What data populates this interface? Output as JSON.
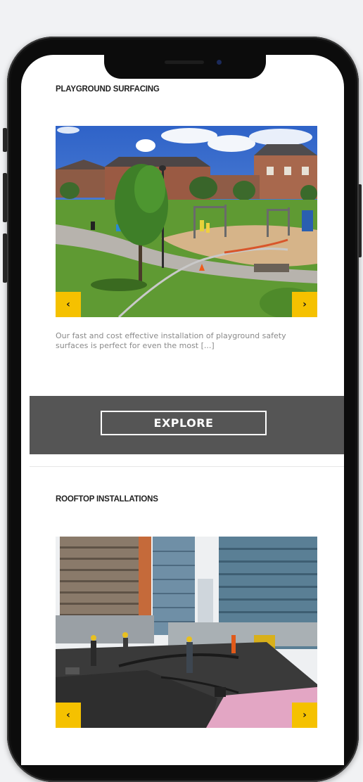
{
  "sections": [
    {
      "title": "PLAYGROUND SURFACING",
      "excerpt": "Our fast and cost effective installation of playground safety surfaces is perfect for even the most [...]",
      "explore_label": "EXPLORE",
      "prev_label": "‹",
      "next_label": "›"
    },
    {
      "title": "ROOFTOP INSTALLATIONS",
      "prev_label": "‹",
      "next_label": "›"
    }
  ],
  "colors": {
    "accent": "#f5c100",
    "band": "#555555",
    "background": "#f1f2f4"
  },
  "icons": {
    "prev": "chevron-left-icon",
    "next": "chevron-right-icon"
  }
}
